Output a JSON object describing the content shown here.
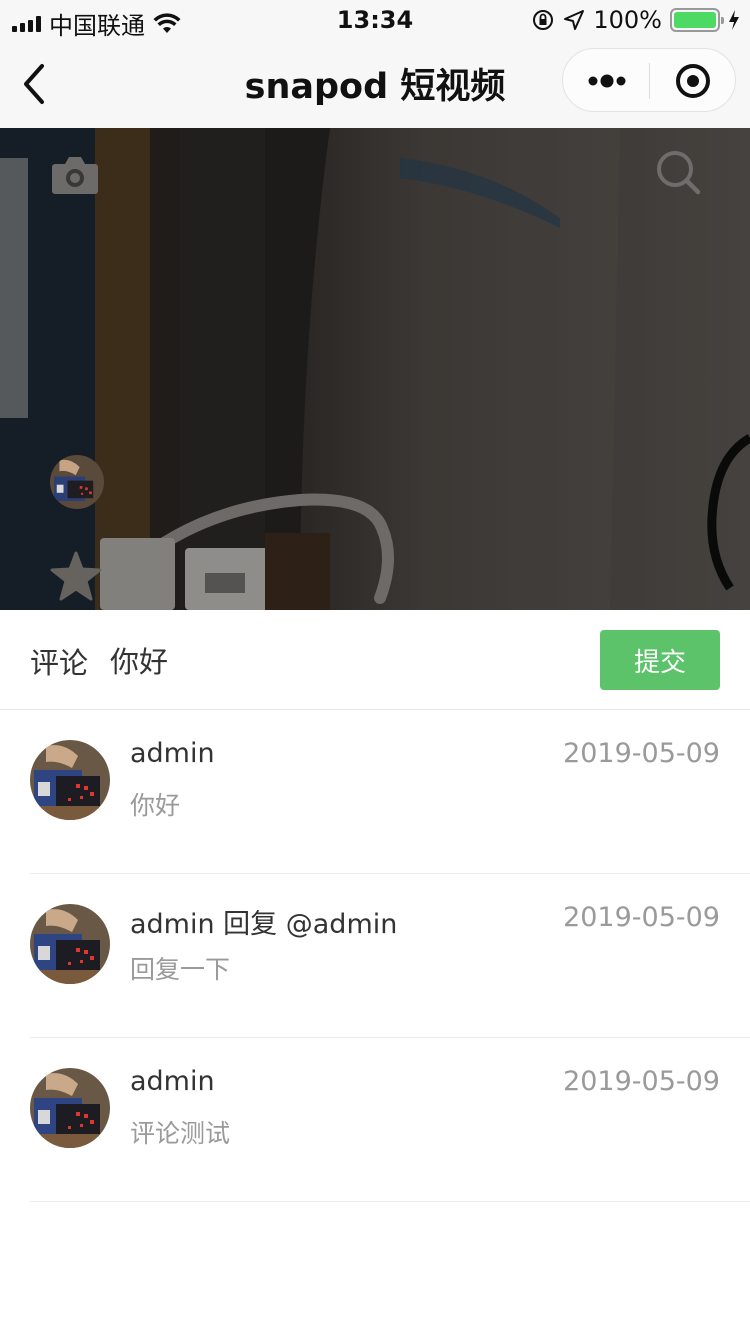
{
  "status_bar": {
    "carrier": "中国联通",
    "time": "13:34",
    "battery": "100%",
    "battery_level": 1.0
  },
  "nav": {
    "title": "snapod 短视频",
    "icons": {
      "back": "chevron-left-icon",
      "more": "more-dots-icon",
      "close": "target-circle-icon"
    }
  },
  "video": {
    "icons": {
      "camera": "camera-icon",
      "search": "search-icon",
      "star": "star-icon"
    }
  },
  "comment_input": {
    "label": "评论",
    "value": "你好",
    "submit_label": "提交"
  },
  "comments": [
    {
      "user": "admin",
      "date": "2019-05-09",
      "text": "你好"
    },
    {
      "user": "admin 回复 @admin",
      "date": "2019-05-09",
      "text": "回复一下"
    },
    {
      "user": "admin",
      "date": "2019-05-09",
      "text": "评论测试"
    }
  ],
  "colors": {
    "accent": "#5cc36b",
    "battery": "#4cd964",
    "muted_text": "#9a9a9a"
  }
}
